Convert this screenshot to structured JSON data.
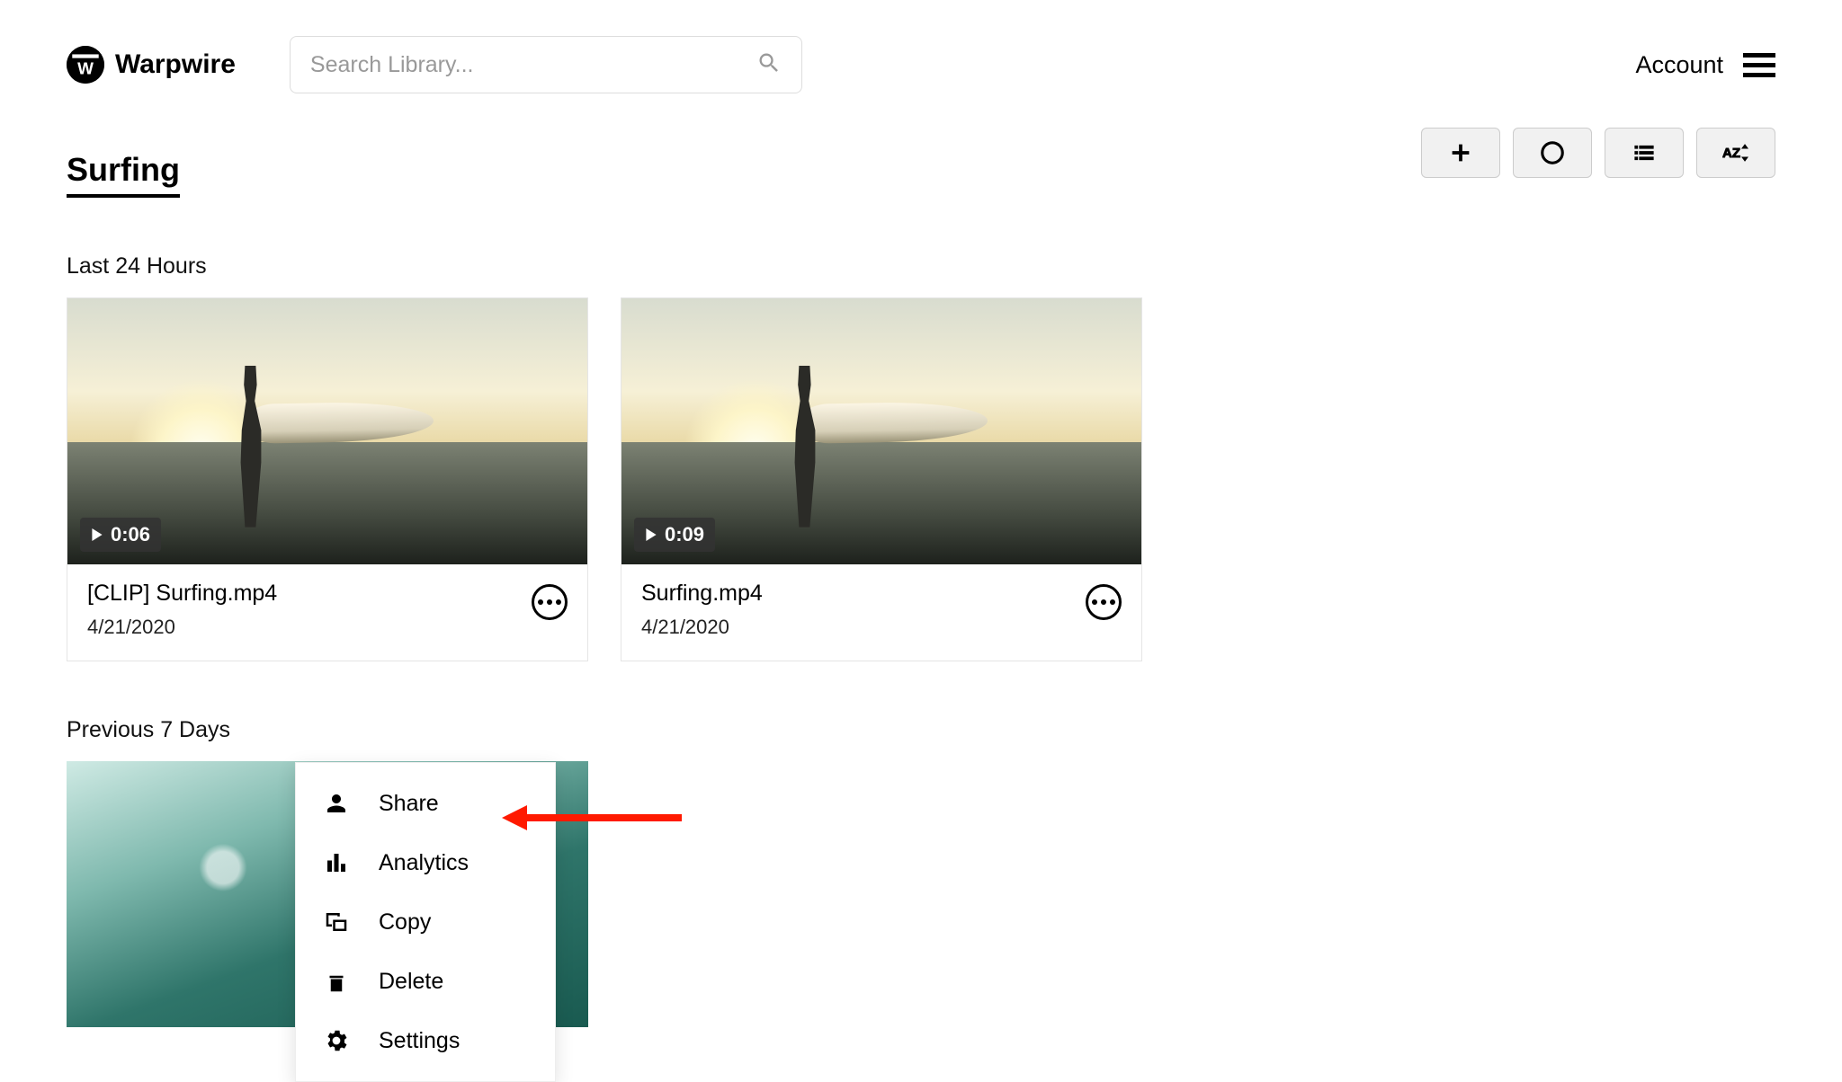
{
  "header": {
    "brand": "Warpwire",
    "search_placeholder": "Search Library...",
    "account_label": "Account"
  },
  "library": {
    "title": "Surfing",
    "sections": [
      {
        "label": "Last 24 Hours",
        "items": [
          {
            "title": "[CLIP] Surfing.mp4",
            "date": "4/21/2020",
            "duration": "0:06"
          },
          {
            "title": "Surfing.mp4",
            "date": "4/21/2020",
            "duration": "0:09"
          }
        ]
      },
      {
        "label": "Previous 7 Days",
        "items": []
      }
    ]
  },
  "context_menu": {
    "items": [
      {
        "icon": "person-icon",
        "label": "Share"
      },
      {
        "icon": "barchart-icon",
        "label": "Analytics"
      },
      {
        "icon": "copy-icon",
        "label": "Copy"
      },
      {
        "icon": "trash-icon",
        "label": "Delete"
      },
      {
        "icon": "gear-icon",
        "label": "Settings"
      }
    ]
  },
  "toolbar": {
    "add": "Add",
    "record": "Record",
    "view": "List view",
    "sort": "Sort A-Z"
  }
}
